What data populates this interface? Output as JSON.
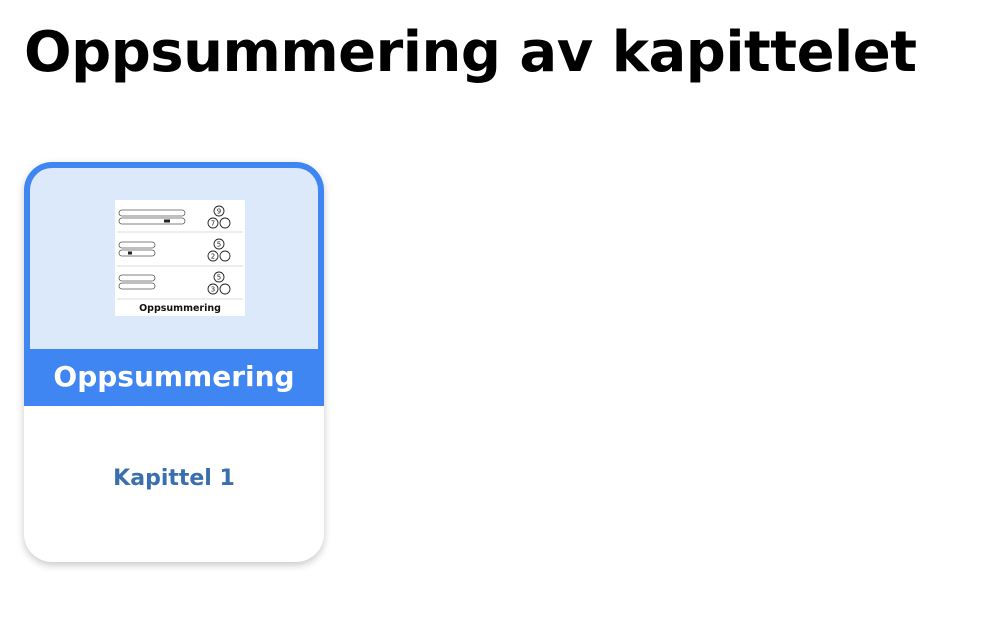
{
  "page": {
    "title": "Oppsummering av kapittelet"
  },
  "cards": [
    {
      "label": "Oppsummering",
      "subtitle": "Kapittel 1",
      "thumbnail_caption": "Oppsummering",
      "thumbnail_rows": [
        {
          "top": "9",
          "left": "7",
          "right": ""
        },
        {
          "top": "5",
          "left": "2",
          "right": ""
        },
        {
          "top": "5",
          "left": "3",
          "right": ""
        }
      ]
    }
  ],
  "colors": {
    "accent": "#3f86f2",
    "thumb_background": "#dbe9fb",
    "subtitle": "#3a6fae"
  }
}
